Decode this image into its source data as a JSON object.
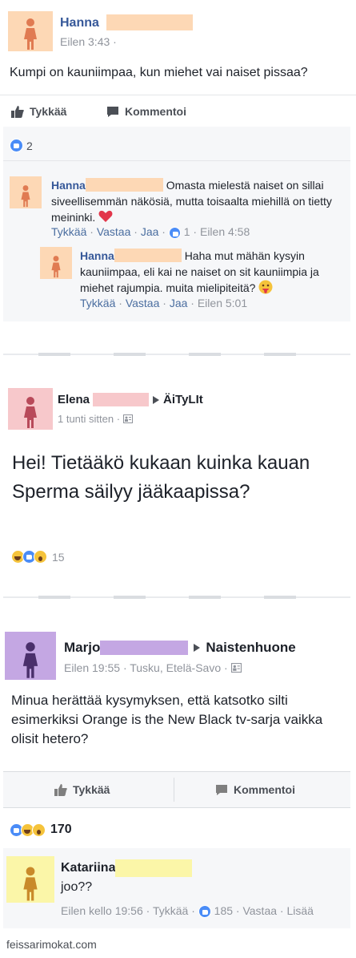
{
  "post1": {
    "author": "Hanna",
    "time": "Eilen 3:43 ·",
    "text": "Kumpi on kauniimpaa, kun miehet vai naiset pissaa?",
    "actions": {
      "like": "Tykkää",
      "comment": "Kommentoi"
    },
    "like_count": "2",
    "comments": [
      {
        "author": "Hanna",
        "text": "Omasta mielestä naiset on sillai siveellisemmän näkösiä, mutta toisaalta miehillä on tietty meininki.",
        "meta": {
          "like": "Tykkää",
          "reply": "Vastaa",
          "share": "Jaa",
          "likes": "1",
          "time": "Eilen 4:58"
        }
      },
      {
        "author": "Hanna",
        "text": "Haha mut mähän kysyin kauniimpaa, eli kai ne naiset on sit kauniimpia ja miehet rajumpia. muita mielipiteitä?",
        "meta": {
          "like": "Tykkää",
          "reply": "Vastaa",
          "share": "Jaa",
          "time": "Eilen 5:01"
        }
      }
    ]
  },
  "post2": {
    "author": "Elena",
    "group": "ÄiTyLIt",
    "time": "1 tunti sitten ·",
    "text": "Hei! Tietääkö kukaan kuinka kauan Sperma säilyy jääkaapissa?",
    "reaction_count": "15"
  },
  "post3": {
    "author": "Marjo",
    "group": "Naistenhuone",
    "time": "Eilen 19:55 · Tusku, Etelä-Savo ·",
    "text": "Minua herättää kysymyksen, että katsotko silti esimerkiksi Orange is the New Black tv-sarja vaikka olisit hetero?",
    "actions": {
      "like": "Tykkää",
      "comment": "Kommentoi"
    },
    "reaction_count": "170",
    "comment": {
      "author": "Katariina",
      "text": "joo??",
      "meta": {
        "time": "Eilen kello 19:56",
        "like": "Tykkää",
        "likes": "185",
        "reply": "Vastaa",
        "more": "Lisää"
      }
    }
  },
  "watermark": "feissarimokat.com",
  "colors": {
    "name_blue": "#365899",
    "like_blue": "#4a8cf7",
    "peach": "#fdd8b5",
    "pink": "#f7c8cb",
    "purple": "#c4a7e3",
    "yellow": "#fbf6a8"
  }
}
